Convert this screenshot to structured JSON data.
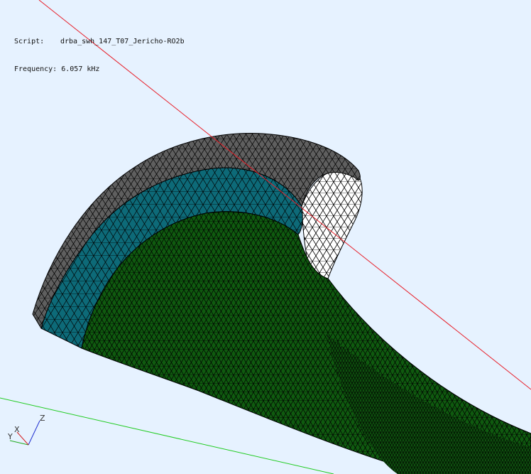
{
  "info": {
    "script_label": "Script:",
    "script_value": "drba_swh_147_T07_Jericho-RO2b",
    "frequency_label": "Frequency:",
    "frequency_value": "6.057 kHz"
  },
  "axes": {
    "x_label": "X",
    "y_label": "Y",
    "z_label": "Z"
  },
  "colors": {
    "background": "#e6f2ff",
    "red_line": "#e8202a",
    "green_line": "#22cc22",
    "gray_shell": "#5f5f5f",
    "teal_layer": "#0d6a78",
    "green_surface": "#0f5a0f",
    "white_wall": "#ffffff",
    "mesh_edge": "#000000",
    "axis_x": "#d62020",
    "axis_y": "#20aa20",
    "axis_z": "#2030d0"
  }
}
